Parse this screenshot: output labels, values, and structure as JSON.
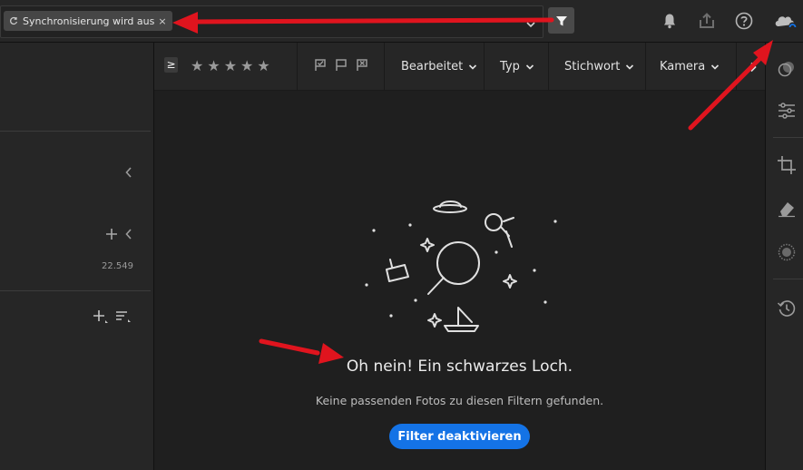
{
  "topbar": {
    "sync_chip": {
      "label": "Synchronisierung wird aus ...",
      "close": "×"
    }
  },
  "left_panel": {
    "count": "22.549"
  },
  "filter_bar": {
    "rating_operator": "≥",
    "stars": [
      "★",
      "★",
      "★",
      "★",
      "★"
    ],
    "dropdowns": [
      {
        "label": "Bearbeitet"
      },
      {
        "label": "Typ"
      },
      {
        "label": "Stichwort"
      },
      {
        "label": "Kamera"
      }
    ]
  },
  "empty_state": {
    "title": "Oh nein! Ein schwarzes Loch.",
    "subtitle": "Keine passenden Fotos zu diesen Filtern gefunden.",
    "button": "Filter deaktivieren"
  },
  "colors": {
    "accent": "#1473e6",
    "annotation_arrow": "#e0141e",
    "cloud_status": "#1473e6"
  },
  "icons": [
    "sync-icon",
    "close-icon",
    "chevron-down-icon",
    "filter-icon",
    "bell-icon",
    "share-icon",
    "help-icon",
    "cloud-sync-icon",
    "chevron-left-icon",
    "add-icon",
    "sort-icon",
    "flag-pick-icon",
    "flag-unflag-icon",
    "flag-reject-icon",
    "chevron-right-icon",
    "presets-icon",
    "edit-sliders-icon",
    "crop-icon",
    "healing-icon",
    "masking-icon",
    "versions-icon",
    "black-hole-illustration"
  ]
}
